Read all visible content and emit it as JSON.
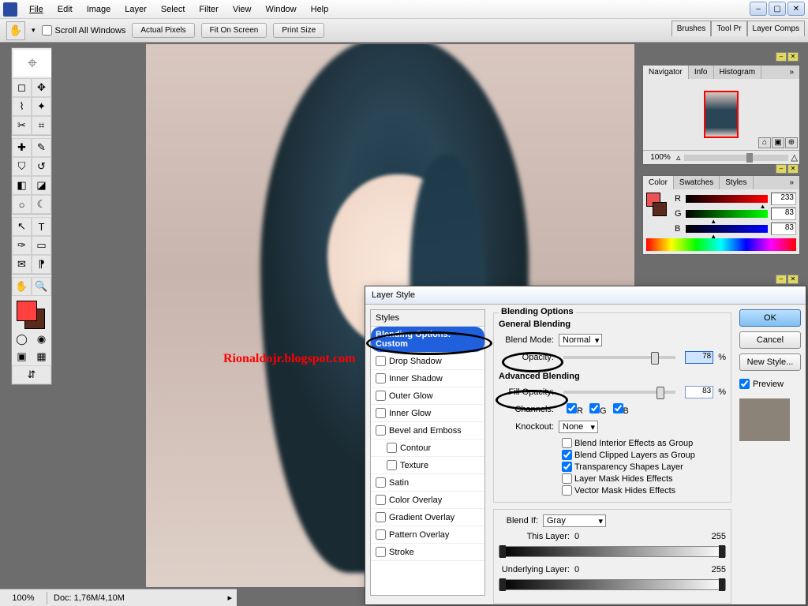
{
  "menu": {
    "items": [
      "File",
      "Edit",
      "Image",
      "Layer",
      "Select",
      "Filter",
      "View",
      "Window",
      "Help"
    ]
  },
  "options": {
    "scroll_all": "Scroll All Windows",
    "btn1": "Actual Pixels",
    "btn2": "Fit On Screen",
    "btn3": "Print Size",
    "tabs": [
      "Brushes",
      "Tool Pr",
      "Layer Comps"
    ]
  },
  "status": {
    "zoom": "100%",
    "doc": "Doc: 1,76M/4,10M"
  },
  "watermark": "Rionaldojr.blogspot.com",
  "navigator": {
    "tab1": "Navigator",
    "tab2": "Info",
    "tab3": "Histogram",
    "zoom": "100%"
  },
  "color": {
    "tab1": "Color",
    "tab2": "Swatches",
    "tab3": "Styles",
    "r_label": "R",
    "g_label": "G",
    "b_label": "B",
    "r": "233",
    "g": "83",
    "b": "83"
  },
  "dialog": {
    "title": "Layer Style",
    "styles_hdr": "Styles",
    "items": [
      {
        "label": "Blending Options: Custom",
        "sel": true
      },
      {
        "label": "Drop Shadow"
      },
      {
        "label": "Inner Shadow"
      },
      {
        "label": "Outer Glow"
      },
      {
        "label": "Inner Glow"
      },
      {
        "label": "Bevel and Emboss"
      },
      {
        "label": "Contour",
        "indent": true
      },
      {
        "label": "Texture",
        "indent": true
      },
      {
        "label": "Satin"
      },
      {
        "label": "Color Overlay"
      },
      {
        "label": "Gradient Overlay"
      },
      {
        "label": "Pattern Overlay"
      },
      {
        "label": "Stroke"
      }
    ],
    "heading": "Blending Options",
    "gen_hdr": "General Blending",
    "mode_label": "Blend Mode:",
    "mode_val": "Normal",
    "opacity_label": "Opacity:",
    "opacity_val": "78",
    "pct": "%",
    "adv_hdr": "Advanced Blending",
    "fill_label": "Fill Opacity:",
    "fill_val": "83",
    "channels_label": "Channels:",
    "ch_r": "R",
    "ch_g": "G",
    "ch_b": "B",
    "knockout_label": "Knockout:",
    "knockout_val": "None",
    "opts": [
      {
        "label": "Blend Interior Effects as Group",
        "ck": false
      },
      {
        "label": "Blend Clipped Layers as Group",
        "ck": true
      },
      {
        "label": "Transparency Shapes Layer",
        "ck": true
      },
      {
        "label": "Layer Mask Hides Effects",
        "ck": false
      },
      {
        "label": "Vector Mask Hides Effects",
        "ck": false
      }
    ],
    "blendif_label": "Blend If:",
    "blendif_val": "Gray",
    "this_layer": "This Layer:",
    "this_lo": "0",
    "this_hi": "255",
    "under_layer": "Underlying Layer:",
    "under_lo": "0",
    "under_hi": "255",
    "ok": "OK",
    "cancel": "Cancel",
    "newstyle": "New Style...",
    "preview": "Preview"
  }
}
